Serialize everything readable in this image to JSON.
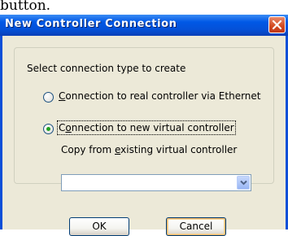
{
  "caption_fragment": "button.",
  "dialog": {
    "title": "New Controller Connection",
    "prompt": "Select connection type to create",
    "option_real": {
      "mnemonic": "C",
      "rest": "onnection to real controller via Ethernet",
      "selected": false
    },
    "option_virtual": {
      "prefix": "C",
      "mnemonic": "o",
      "rest": "nnection to new virtual controller",
      "selected": true
    },
    "copy_label": {
      "prefix": "Copy from ",
      "mnemonic": "e",
      "rest": "xisting virtual controller"
    },
    "copy_value": "",
    "ok_label": "OK",
    "cancel_label": "Cancel"
  },
  "colors": {
    "title_bar": "#0058e6",
    "dialog_bg": "#ece9d8",
    "close_button": "#d3491f",
    "radio_dot": "#21a121"
  },
  "icons": {
    "close": "close-icon",
    "dropdown": "chevron-down-icon"
  }
}
